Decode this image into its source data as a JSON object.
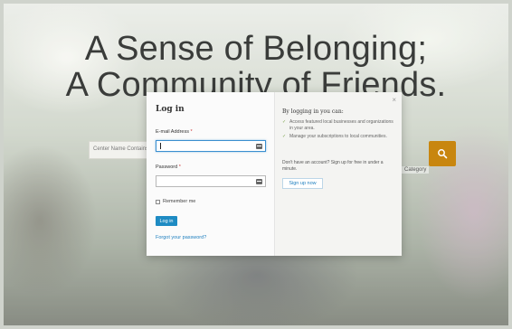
{
  "hero": {
    "line1": "A Sense of Belonging;",
    "line2": "A Community of Friends."
  },
  "background_search": {
    "placeholder": "Center Name Contains",
    "category_chip": "Category"
  },
  "modal": {
    "close_label": "×",
    "login": {
      "title": "Log in",
      "email_label": "E-mail Address",
      "password_label": "Password",
      "required_mark": "*",
      "email_value": "",
      "password_value": "",
      "remember_label": "Remember me",
      "login_button": "Log in",
      "forgot_link": "Forgot your password?"
    },
    "info": {
      "title": "By logging in you can:",
      "benefits": [
        "Access featured local businesses and organizations in your area.",
        "Manage your subscriptions to local communities."
      ],
      "no_account_text": "Don't have an account? Sign up for free in under a minute.",
      "signup_button": "Sign up now"
    }
  },
  "icons": {
    "search": "search-icon",
    "email_field": "id-card-icon",
    "password_field": "id-card-icon",
    "check": "check-icon"
  },
  "colors": {
    "primary": "#1e8bc3",
    "link": "#1e7fbf",
    "search_button": "#c8860f",
    "check": "#7aa34a"
  }
}
